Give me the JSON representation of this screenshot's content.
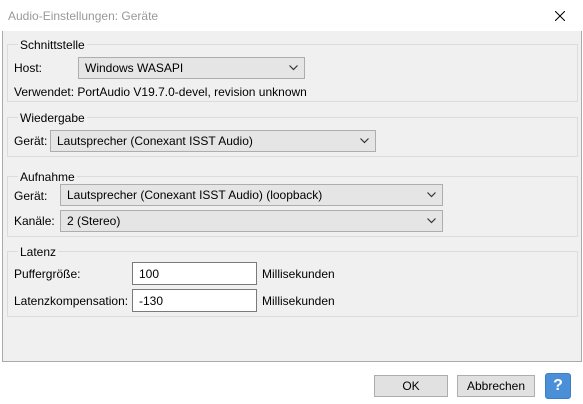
{
  "window": {
    "title": "Audio-Einstellungen: Geräte"
  },
  "interface": {
    "title": "Schnittstelle",
    "host_label": "Host:",
    "host_value": "Windows WASAPI",
    "using_label": "Verwendet: PortAudio V19.7.0-devel, revision unknown"
  },
  "playback": {
    "title": "Wiedergabe",
    "device_label": "Gerät:",
    "device_value": "Lautsprecher (Conexant ISST Audio)"
  },
  "recording": {
    "title": "Aufnahme",
    "device_label": "Gerät:",
    "device_value": "Lautsprecher (Conexant ISST Audio) (loopback)",
    "channels_label": "Kanäle:",
    "channels_value": "2 (Stereo)"
  },
  "latency": {
    "title": "Latenz",
    "buffer_label": "Puffergröße:",
    "buffer_value": "100",
    "buffer_unit": "Millisekunden",
    "compensation_label": "Latenzkompensation:",
    "compensation_value": "-130",
    "compensation_unit": "Millisekunden"
  },
  "buttons": {
    "ok_label": "OK",
    "cancel_label": "Abbrechen",
    "help_label": "?"
  },
  "icons": {
    "close": "close-icon",
    "dropdown": "chevron-down-icon"
  },
  "colors": {
    "help_button": "#4a8fd8",
    "panel_background": "#f0f0f0"
  }
}
